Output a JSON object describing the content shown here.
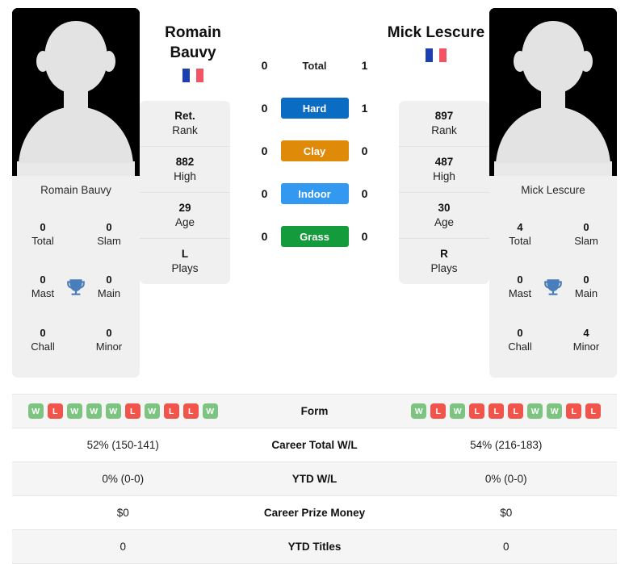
{
  "players": {
    "left": {
      "name_lines": [
        "Romain",
        "Bauvy"
      ],
      "full_name": "Romain Bauvy",
      "flag": "france-flag-icon",
      "titles": [
        {
          "value": "0",
          "label": "Total"
        },
        {
          "value": "0",
          "label": "Slam"
        },
        {
          "value": "0",
          "label": "Mast"
        },
        {
          "value": "0",
          "label": "Main"
        },
        {
          "value": "0",
          "label": "Chall"
        },
        {
          "value": "0",
          "label": "Minor"
        }
      ],
      "stats": [
        {
          "value": "Ret.",
          "label": "Rank"
        },
        {
          "value": "882",
          "label": "High"
        },
        {
          "value": "29",
          "label": "Age"
        },
        {
          "value": "L",
          "label": "Plays"
        }
      ],
      "form": [
        "W",
        "L",
        "W",
        "W",
        "W",
        "L",
        "W",
        "L",
        "L",
        "W"
      ],
      "career_total_wl": "52% (150-141)",
      "ytd_wl": "0% (0-0)",
      "career_prize_money": "$0",
      "ytd_titles": "0"
    },
    "right": {
      "name_lines": [
        "Mick Lescure"
      ],
      "full_name": "Mick Lescure",
      "flag": "france-flag-icon",
      "titles": [
        {
          "value": "4",
          "label": "Total"
        },
        {
          "value": "0",
          "label": "Slam"
        },
        {
          "value": "0",
          "label": "Mast"
        },
        {
          "value": "0",
          "label": "Main"
        },
        {
          "value": "0",
          "label": "Chall"
        },
        {
          "value": "4",
          "label": "Minor"
        }
      ],
      "stats": [
        {
          "value": "897",
          "label": "Rank"
        },
        {
          "value": "487",
          "label": "High"
        },
        {
          "value": "30",
          "label": "Age"
        },
        {
          "value": "R",
          "label": "Plays"
        }
      ],
      "form": [
        "W",
        "L",
        "W",
        "L",
        "L",
        "L",
        "W",
        "W",
        "L",
        "L"
      ],
      "career_total_wl": "54% (216-183)",
      "ytd_wl": "0% (0-0)",
      "career_prize_money": "$0",
      "ytd_titles": "0"
    }
  },
  "head_to_head": [
    {
      "label": "Total",
      "left": "0",
      "right": "1",
      "color": "transparent",
      "style": "plain"
    },
    {
      "label": "Hard",
      "left": "0",
      "right": "1",
      "color": "#0b6cc4",
      "style": "pill"
    },
    {
      "label": "Clay",
      "left": "0",
      "right": "0",
      "color": "#e08a0a",
      "style": "pill"
    },
    {
      "label": "Indoor",
      "left": "0",
      "right": "0",
      "color": "#3399f0",
      "style": "pill"
    },
    {
      "label": "Grass",
      "left": "0",
      "right": "0",
      "color": "#149b3c",
      "style": "pill"
    }
  ],
  "table_rows": [
    {
      "label": "Form",
      "type": "form"
    },
    {
      "label": "Career Total W/L",
      "left": "52% (150-141)",
      "right": "54% (216-183)"
    },
    {
      "label": "YTD W/L",
      "left": "0% (0-0)",
      "right": "0% (0-0)"
    },
    {
      "label": "Career Prize Money",
      "left": "$0",
      "right": "$0"
    },
    {
      "label": "YTD Titles",
      "left": "0",
      "right": "0"
    }
  ],
  "colors": {
    "win_badge": "#7cc47f",
    "loss_badge": "#f0544a",
    "card_bg": "#f0f0f0",
    "row_alt_bg": "#f5f5f5"
  }
}
